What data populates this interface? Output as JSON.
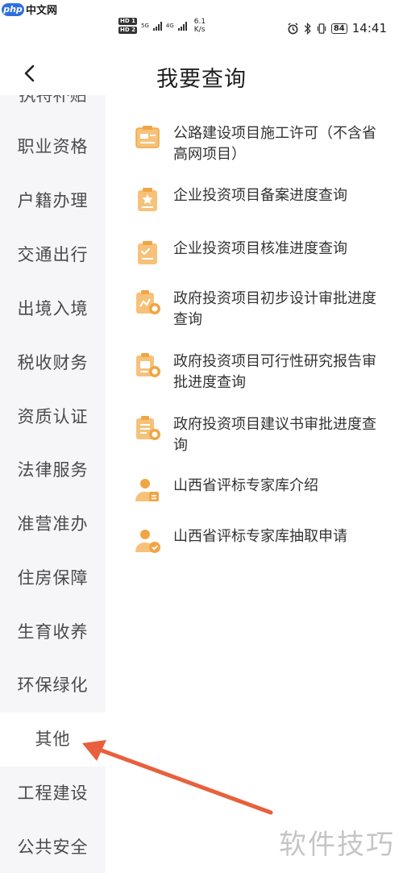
{
  "watermark": {
    "badge": "php",
    "site": "中文网",
    "bottom": "软件技巧"
  },
  "status": {
    "hd1": "HD 1",
    "hd2": "HD 2",
    "net1": "5G",
    "net2": "4G",
    "speed_value": "6.1",
    "speed_unit": "K/s",
    "battery": "84",
    "time": "14:41",
    "icons": [
      "alarm-icon",
      "bluetooth-icon",
      "vibrate-icon"
    ]
  },
  "header": {
    "title": "我要查询"
  },
  "sidebar": {
    "partial_item": "执特补贴",
    "items": [
      {
        "label": "职业资格"
      },
      {
        "label": "户籍办理"
      },
      {
        "label": "交通出行"
      },
      {
        "label": "出境入境"
      },
      {
        "label": "税收财务"
      },
      {
        "label": "资质认证"
      },
      {
        "label": "法律服务"
      },
      {
        "label": "准营准办"
      },
      {
        "label": "住房保障"
      },
      {
        "label": "生育收养"
      },
      {
        "label": "环保绿化"
      },
      {
        "label": "其他"
      },
      {
        "label": "工程建设"
      },
      {
        "label": "公共安全"
      }
    ],
    "active_index": 11
  },
  "list": {
    "accent_color": "#f3ab4a",
    "items": [
      {
        "label": "公路建设项目施工许可（不含省高网项目）",
        "icon": "license-icon"
      },
      {
        "label": "企业投资项目备案进度查询",
        "icon": "star-document-icon"
      },
      {
        "label": "企业投资项目核准进度查询",
        "icon": "checklist-document-icon"
      },
      {
        "label": "政府投资项目初步设计审批进度查询",
        "icon": "design-approval-icon"
      },
      {
        "label": "政府投资项目可行性研究报告审批进度查询",
        "icon": "report-approval-icon"
      },
      {
        "label": "政府投资项目建议书审批进度查询",
        "icon": "proposal-approval-icon"
      },
      {
        "label": "山西省评标专家库介绍",
        "icon": "expert-info-icon"
      },
      {
        "label": "山西省评标专家库抽取申请",
        "icon": "expert-apply-icon"
      }
    ]
  }
}
